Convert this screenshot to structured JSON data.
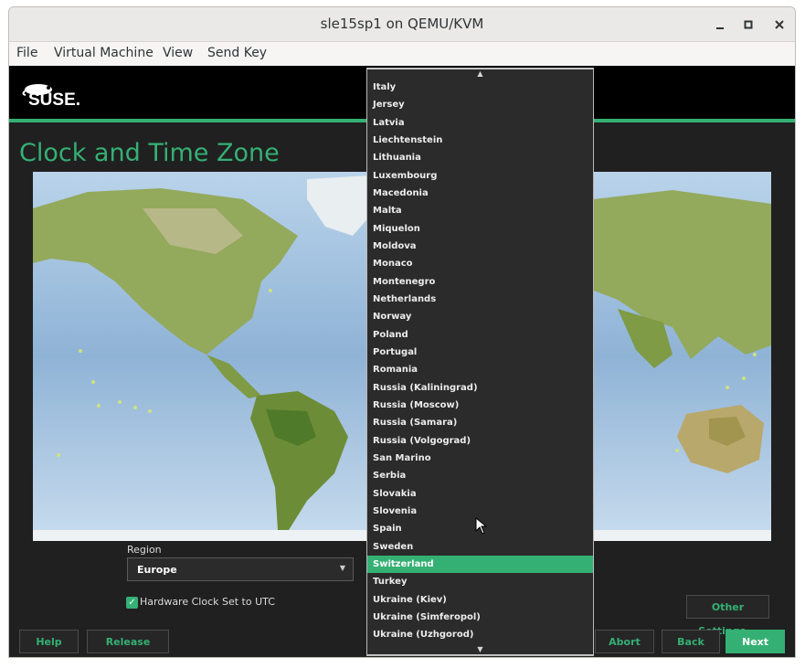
{
  "window": {
    "title": "sle15sp1 on QEMU/KVM",
    "minimize_icon": "minimize-icon",
    "maximize_icon": "maximize-icon",
    "close_icon": "close-icon"
  },
  "menubar": {
    "items": [
      "File",
      "Virtual Machine",
      "View",
      "Send Key"
    ]
  },
  "installer": {
    "logo_text": "SUSE.",
    "page_title": "Clock and Time Zone",
    "region_label": "Region",
    "region_value": "Europe",
    "hw_clock_label": "Hardware Clock Set to UTC",
    "hw_clock_checked": true,
    "buttons": {
      "help": "Help",
      "release_notes": "Release Notes...",
      "abort": "Abort",
      "back": "Back",
      "next": "Next",
      "other_settings": "Other Settings..."
    }
  },
  "timezone_list": {
    "items": [
      "Italy",
      "Jersey",
      "Latvia",
      "Liechtenstein",
      "Lithuania",
      "Luxembourg",
      "Macedonia",
      "Malta",
      "Miquelon",
      "Moldova",
      "Monaco",
      "Montenegro",
      "Netherlands",
      "Norway",
      "Poland",
      "Portugal",
      "Romania",
      "Russia (Kaliningrad)",
      "Russia (Moscow)",
      "Russia (Samara)",
      "Russia (Volgograd)",
      "San Marino",
      "Serbia",
      "Slovakia",
      "Slovenia",
      "Spain",
      "Sweden",
      "Switzerland",
      "Turkey",
      "Ukraine (Kiev)",
      "Ukraine (Simferopol)",
      "Ukraine (Uzhgorod)"
    ],
    "selected": "Switzerland"
  },
  "colors": {
    "accent": "#35b074",
    "dark_background": "#202020"
  }
}
